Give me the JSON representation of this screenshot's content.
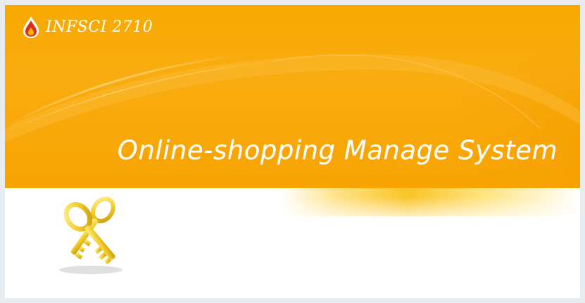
{
  "app": {
    "logo_text": "INFSCI 2710",
    "title": "Online-shopping Manage System"
  },
  "icons": {
    "logo": "flame-drop-icon",
    "keys": "keys-icon"
  },
  "colors": {
    "banner": "#f8a600",
    "background": "#ffffff",
    "key": "#f2cd2c",
    "logo_red": "#d9301c"
  }
}
